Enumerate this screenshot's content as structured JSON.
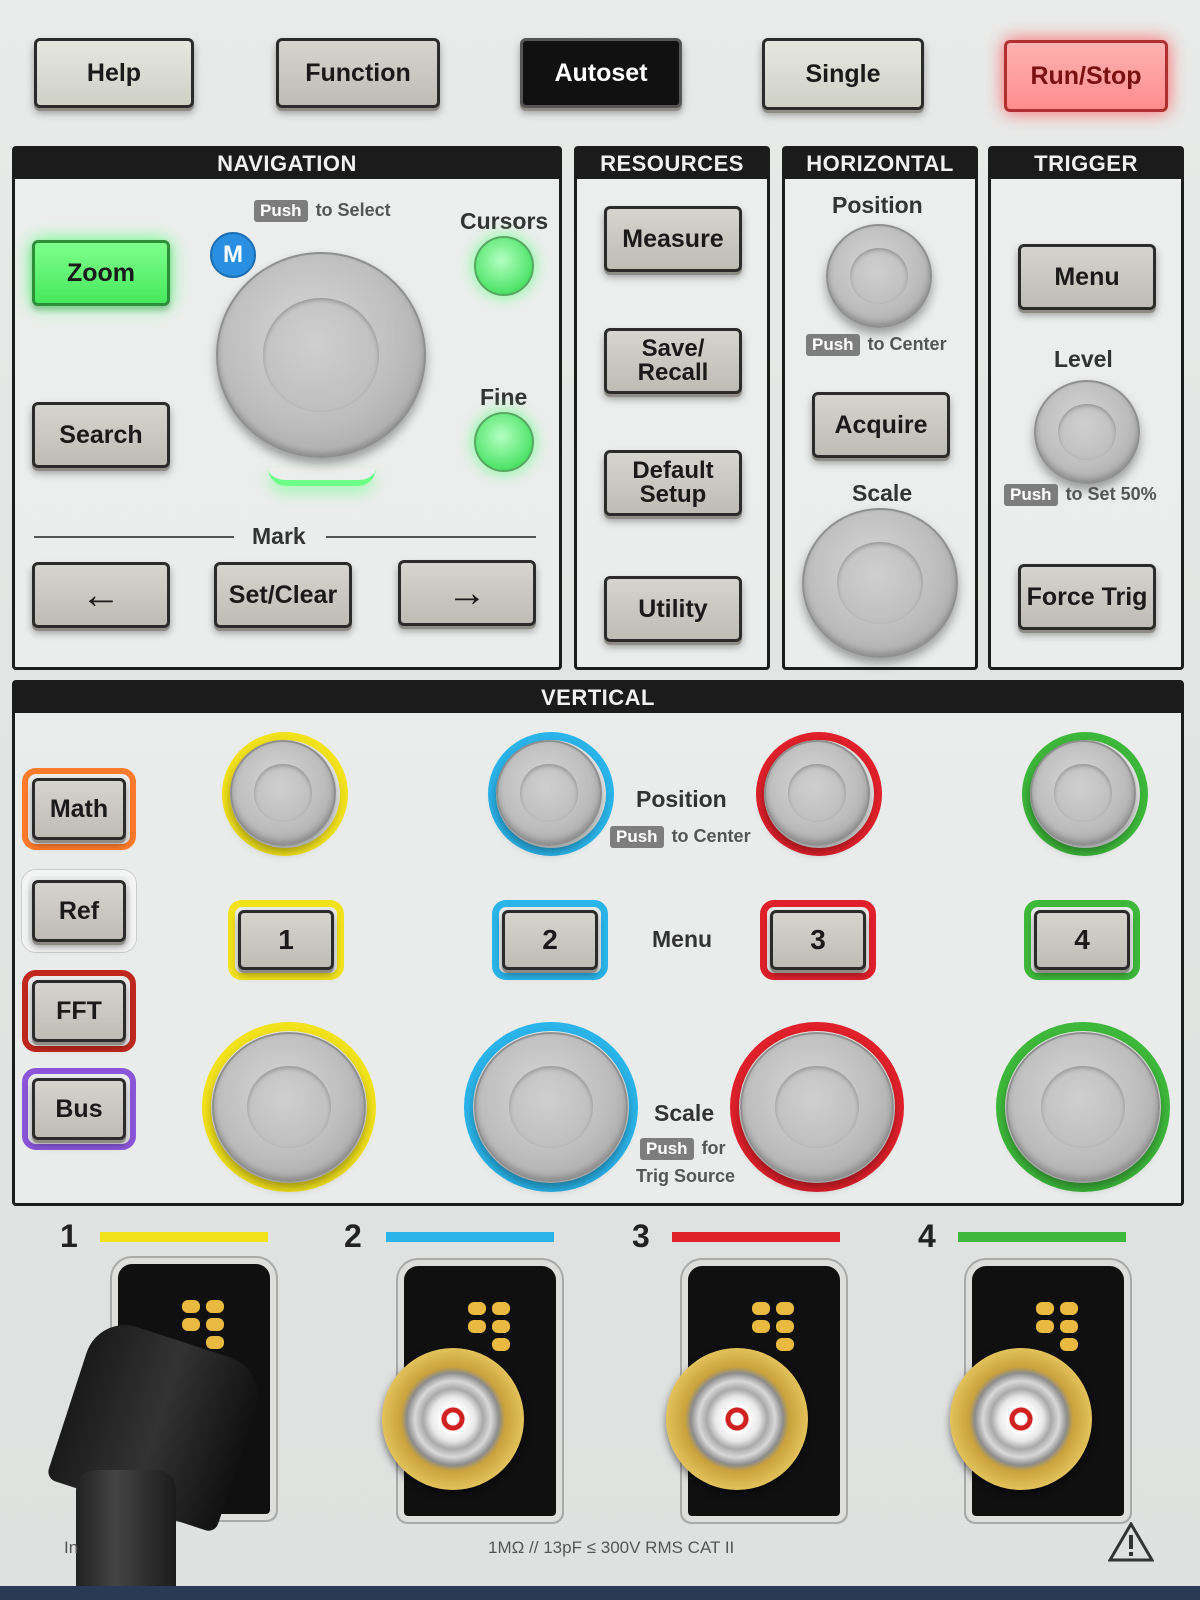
{
  "top_buttons": {
    "help": "Help",
    "function": "Function",
    "autoset": "Autoset",
    "single": "Single",
    "run_stop": "Run/Stop"
  },
  "navigation": {
    "title": "NAVIGATION",
    "push": "Push",
    "push_suffix": "to Select",
    "m_badge": "M",
    "cursors": "Cursors",
    "fine": "Fine",
    "zoom": "Zoom",
    "search": "Search",
    "mark": "Mark",
    "left_arrow": "←",
    "set_clear": "Set/Clear",
    "right_arrow": "→"
  },
  "resources": {
    "title": "RESOURCES",
    "measure": "Measure",
    "save_recall_1": "Save/",
    "save_recall_2": "Recall",
    "default_setup_1": "Default",
    "default_setup_2": "Setup",
    "utility": "Utility"
  },
  "horizontal": {
    "title": "HORIZONTAL",
    "position": "Position",
    "push": "Push",
    "push_suffix": "to Center",
    "acquire": "Acquire",
    "scale": "Scale"
  },
  "trigger": {
    "title": "TRIGGER",
    "menu": "Menu",
    "level": "Level",
    "push": "Push",
    "push_suffix": "to Set 50%",
    "force_trig": "Force Trig"
  },
  "vertical": {
    "title": "VERTICAL",
    "math": "Math",
    "ref": "Ref",
    "fft": "FFT",
    "bus": "Bus",
    "position": "Position",
    "push": "Push",
    "push_position_suffix": "to Center",
    "menu": "Menu",
    "scale": "Scale",
    "push_scale_suffix": "for",
    "push_scale_line2": "Trig Source",
    "ch1": "1",
    "ch2": "2",
    "ch3": "3",
    "ch4": "4"
  },
  "channels": {
    "labels": [
      "1",
      "2",
      "3",
      "4"
    ],
    "colors": [
      "#f2e21a",
      "#2ab4ea",
      "#e0202a",
      "#3db83a"
    ]
  },
  "footer": {
    "spec": "1MΩ // 13pF ≤ 300V RMS CAT II",
    "left_fragment": "In"
  },
  "colors": {
    "zoom_led": "#5cff7a",
    "run_stop": "#ff8d8d",
    "math_ring": "#ff7a2a",
    "ref_ring": "#f4f4f4",
    "fft_ring": "#c0281e",
    "bus_ring": "#8a55d8"
  }
}
